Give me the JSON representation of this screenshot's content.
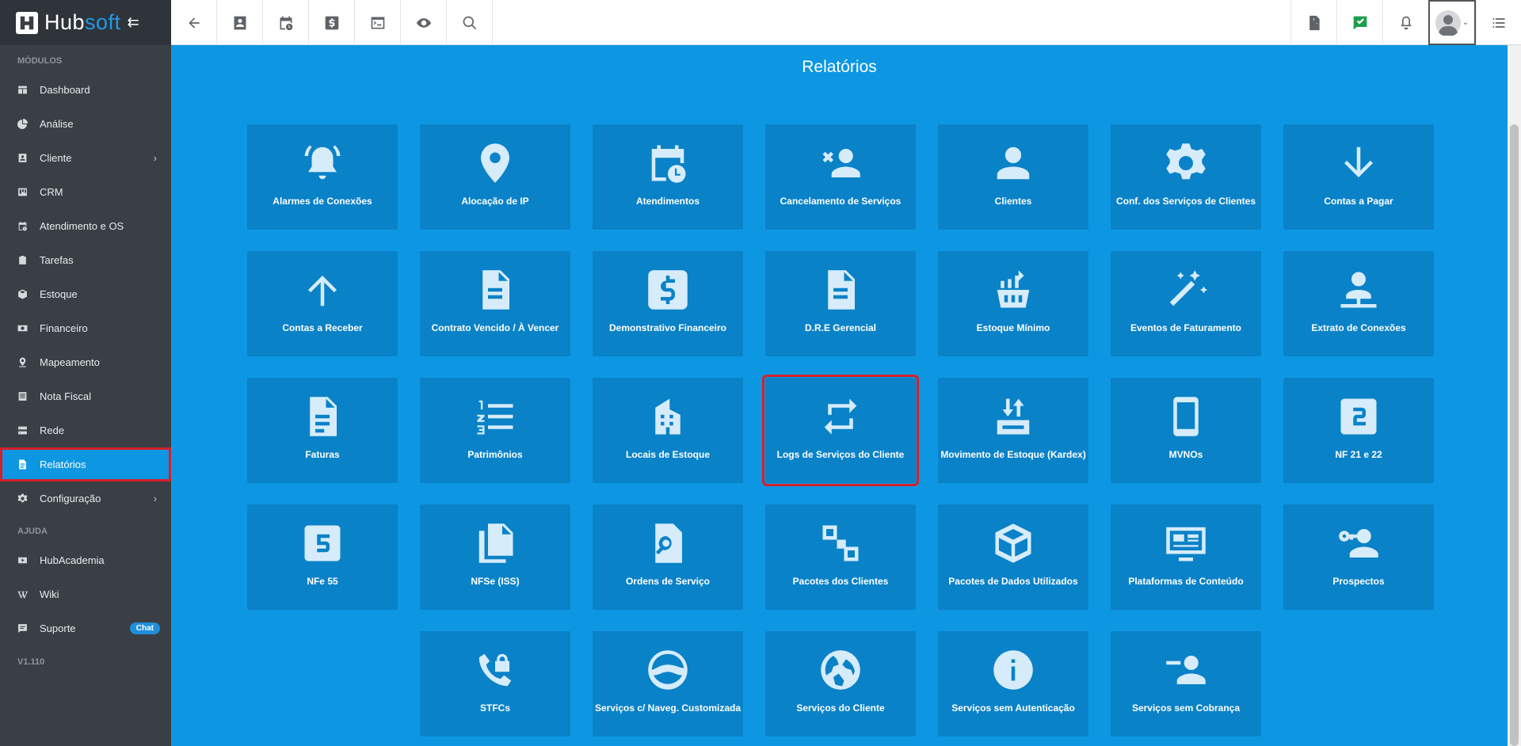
{
  "brand": {
    "name_a": "Hub",
    "name_b": "soft"
  },
  "sidebar": {
    "section_modules": "MÓDULOS",
    "items": [
      {
        "label": "Dashboard"
      },
      {
        "label": "Análise"
      },
      {
        "label": "Cliente",
        "chevron": "›"
      },
      {
        "label": "CRM"
      },
      {
        "label": "Atendimento e OS"
      },
      {
        "label": "Tarefas"
      },
      {
        "label": "Estoque"
      },
      {
        "label": "Financeiro"
      },
      {
        "label": "Mapeamento"
      },
      {
        "label": "Nota Fiscal"
      },
      {
        "label": "Rede"
      },
      {
        "label": "Relatórios"
      },
      {
        "label": "Configuração",
        "chevron": "›"
      }
    ],
    "section_help": "AJUDA",
    "help_items": [
      {
        "label": "HubAcademia"
      },
      {
        "label": "Wiki"
      },
      {
        "label": "Suporte",
        "badge": "Chat"
      }
    ],
    "version": "V1.110"
  },
  "page": {
    "title": "Relatórios"
  },
  "tiles": [
    {
      "label": "Alarmes de Conexões",
      "icon": "bell-icon"
    },
    {
      "label": "Alocação de IP",
      "icon": "map-pin-icon"
    },
    {
      "label": "Atendimentos",
      "icon": "calendar-clock-icon"
    },
    {
      "label": "Cancelamento de Serviços",
      "icon": "user-remove-icon"
    },
    {
      "label": "Clientes",
      "icon": "user-icon"
    },
    {
      "label": "Conf. dos Serviços de Clientes",
      "icon": "gear-icon"
    },
    {
      "label": "Contas a Pagar",
      "icon": "arrow-down-icon"
    },
    {
      "label": "Contas a Receber",
      "icon": "arrow-up-icon"
    },
    {
      "label": "Contrato Vencido / À Vencer",
      "icon": "document-icon"
    },
    {
      "label": "Demonstrativo Financeiro",
      "icon": "dollar-icon"
    },
    {
      "label": "D.R.E Gerencial",
      "icon": "document-icon"
    },
    {
      "label": "Estoque Mínimo",
      "icon": "basket-icon"
    },
    {
      "label": "Eventos de Faturamento",
      "icon": "magic-wand-icon"
    },
    {
      "label": "Extrato de Conexões",
      "icon": "user-network-icon"
    },
    {
      "label": "Faturas",
      "icon": "invoice-icon"
    },
    {
      "label": "Patrimônios",
      "icon": "numbered-list-icon"
    },
    {
      "label": "Locais de Estoque",
      "icon": "building-icon"
    },
    {
      "label": "Logs de Serviços do Cliente",
      "icon": "repeat-icon",
      "highlighted": true
    },
    {
      "label": "Movimento de Estoque (Kardex)",
      "icon": "box-arrows-icon"
    },
    {
      "label": "MVNOs",
      "icon": "phone-icon"
    },
    {
      "label": "NF 21 e 22",
      "icon": "number-2-icon"
    },
    {
      "label": "NFe 55",
      "icon": "number-5-icon"
    },
    {
      "label": "NFSe (ISS)",
      "icon": "documents-icon"
    },
    {
      "label": "Ordens de Serviço",
      "icon": "file-search-icon"
    },
    {
      "label": "Pacotes dos Clientes",
      "icon": "package-grid-icon"
    },
    {
      "label": "Pacotes de Dados Utilizados",
      "icon": "cube-icon"
    },
    {
      "label": "Plataformas de Conteúdo",
      "icon": "monitor-icon"
    },
    {
      "label": "Prospectos",
      "icon": "user-key-icon"
    },
    {
      "label": "STFCs",
      "icon": "phone-lock-icon"
    },
    {
      "label": "Serviços c/ Naveg. Customizada",
      "icon": "globe-icon"
    },
    {
      "label": "Serviços do Cliente",
      "icon": "globe-icon"
    },
    {
      "label": "Serviços sem Autenticação",
      "icon": "info-icon"
    },
    {
      "label": "Serviços sem Cobrança",
      "icon": "user-minus-icon"
    }
  ]
}
